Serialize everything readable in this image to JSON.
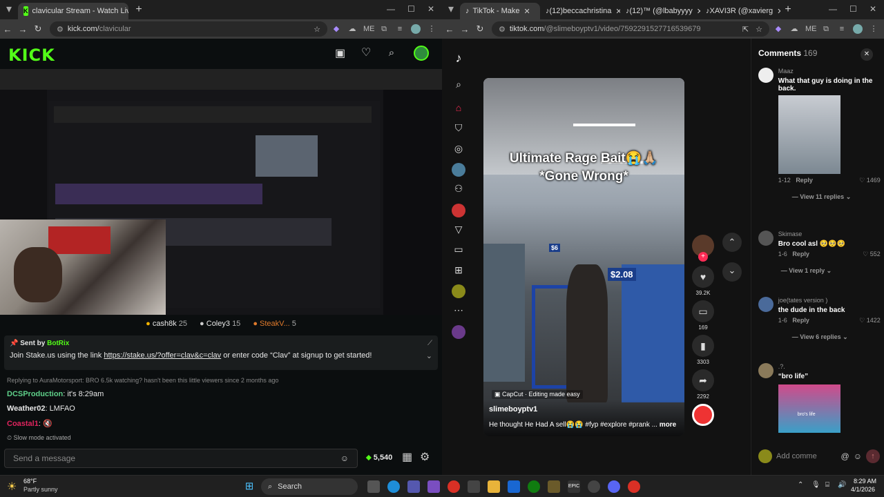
{
  "left_window": {
    "tab_title": "clavicular Stream - Watch Live o",
    "url_host": "kick.com/",
    "url_path": "clavicular",
    "logo": "KICK",
    "viewers": [
      {
        "name": "cash8k",
        "count": "25"
      },
      {
        "name": "Coley3",
        "count": "15"
      },
      {
        "name": "SteakV...",
        "count": "5"
      }
    ],
    "pinned": {
      "sent_by_label": "Sent by",
      "sent_by_name": "BotRix",
      "text_before": "Join Stake.us using the link ",
      "link": "https://stake.us/?offer=clav&c=clav",
      "text_after": " or enter code “Clav” at signup to get started!"
    },
    "chat": {
      "reply_note": "Replying to AuraMotorsport: BRO 6.5k watching? hasn't been this little viewers since 2 months ago",
      "messages": [
        {
          "user": "DCSProduction",
          "text": "it's 8:29am",
          "color": "#5fd18a"
        },
        {
          "user": "Weather02",
          "text": "LMFAO",
          "color": "#e0e0e0"
        },
        {
          "user": "Coastal1",
          "text": "🔇",
          "color": "#e0245e"
        }
      ],
      "slow_mode": "Slow mode activated",
      "send_placeholder": "Send a message",
      "points": "5,540"
    }
  },
  "right_window": {
    "tabs": [
      {
        "title": "TikTok - Make"
      },
      {
        "title": "(12)beccachristina"
      },
      {
        "title": "(12)™ (@lbabyyyy"
      },
      {
        "title": "XAVI3R (@xavierg"
      }
    ],
    "url_host": "tiktok.com",
    "url_path": "/@slimeboyptv1/video/7592291527716539679",
    "video": {
      "overlay_title_1": "Ultimate Rage Bait😭🙏🏼",
      "overlay_title_2": "*Gone Wrong*",
      "capcut": "CapCut · Editing made easy",
      "author": "slimeboyptv1",
      "caption": "He thought He Had A sell😭😭 #fyp #explore #prank ...",
      "more": "more",
      "price_1": "$6",
      "price_2": "$2.08"
    },
    "actions": {
      "likes": "39.2K",
      "comments": "169",
      "saves": "3303",
      "shares": "2292"
    },
    "comments_panel": {
      "title": "Comments",
      "count": "169",
      "items": [
        {
          "user": "Maaz",
          "text": "What that guy is doing in the back.",
          "date": "1-12",
          "reply": "Reply",
          "likes": "1469",
          "view_replies": "View 11 replies"
        },
        {
          "user": "Skimase",
          "text": "Bro cool asl 🥺🥺🥺",
          "date": "1-6",
          "reply": "Reply",
          "likes": "552",
          "view_replies": "View 1 reply"
        },
        {
          "user": "joe(tates version )",
          "text": "the dude in the back",
          "date": "1-6",
          "reply": "Reply",
          "likes": "1422",
          "view_replies": "View 6 replies"
        },
        {
          "user": ".?.",
          "text": "“bro life”",
          "date": "",
          "reply": "",
          "likes": "",
          "view_replies": ""
        }
      ],
      "gif_label": "bro's life",
      "add_comment_placeholder": "Add comme"
    }
  },
  "taskbar": {
    "weather_temp": "68°F",
    "weather_desc": "Partly sunny",
    "search": "Search",
    "time": "8:29 AM",
    "date": "4/1/2026"
  }
}
